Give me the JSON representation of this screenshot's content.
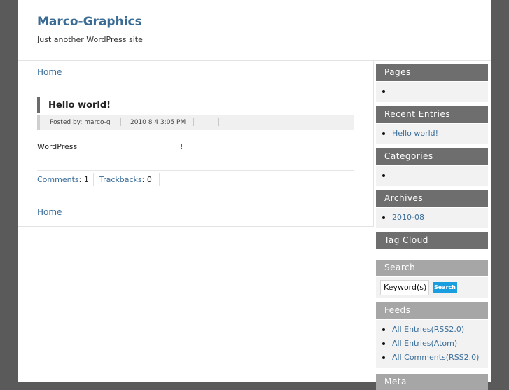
{
  "site": {
    "title": "Marco-Graphics",
    "description": "Just another WordPress site"
  },
  "breadcrumb": {
    "home_label": "Home"
  },
  "post": {
    "title": "Hello world!",
    "posted_by": "Posted by: marco-g",
    "date": "2010 8 4  3:05 PM",
    "content_start": "WordPress",
    "content_end": "!",
    "comments_label": "Comments",
    "comments_count": ": 1",
    "trackbacks_label": "Trackbacks",
    "trackbacks_count": ": 0"
  },
  "sidebar": {
    "pages": {
      "title": "Pages"
    },
    "recent": {
      "title": "Recent Entries",
      "items": [
        "Hello world!"
      ]
    },
    "categories": {
      "title": "Categories"
    },
    "archives": {
      "title": "Archives",
      "items": [
        "2010-08"
      ]
    },
    "tagcloud": {
      "title": "Tag Cloud"
    },
    "search": {
      "title": "Search",
      "input_value": "Keyword(s)",
      "button_label": "Search"
    },
    "feeds": {
      "title": "Feeds",
      "items": [
        "All Entries(RSS2.0)",
        "All Entries(Atom)",
        "All Comments(RSS2.0)"
      ]
    },
    "meta": {
      "title": "Meta"
    }
  }
}
